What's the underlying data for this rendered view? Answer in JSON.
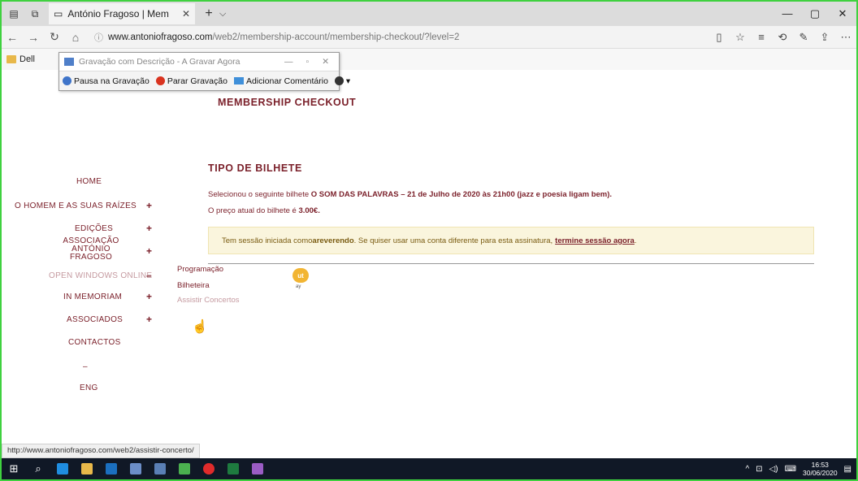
{
  "browser": {
    "tab_title": "António Fragoso | Mem",
    "url_domain": "www.antoniofragoso.com",
    "url_path": "/web2/membership-account/membership-checkout/?level=2",
    "favorites": [
      "Dell"
    ]
  },
  "recorder": {
    "title": "Gravação com Descrição - A Gravar Agora",
    "pause_label": "Pausa na Gravação",
    "stop_label": "Parar Gravação",
    "comment_label": "Adicionar Comentário"
  },
  "page": {
    "heading_checkout": "MEMBERSHIP CHECKOUT",
    "heading_ticket": "TIPO DE BILHETE",
    "ticket_prefix": "Selecionou o seguinte bilhete ",
    "ticket_name": "O SOM DAS PALAVRAS – 21 de Julho de 2020 às 21h00 (jazz e poesia ligam bem).",
    "price_prefix": "O preço atual do bilhete é ",
    "price_value": "3.00€.",
    "notice_prefix": "Tem sessão iniciada como ",
    "notice_user": "areverendo",
    "notice_middle": ". Se quiser usar uma conta diferente para esta assinatura,",
    "notice_link": "termine sessão agora",
    "badge_text": "ut",
    "badge_sub": "ay"
  },
  "nav": {
    "home": "HOME",
    "homem": "O HOMEM E AS SUAS RAÍZES",
    "edicoes": "EDIÇÕES",
    "associacao": "ASSOCIAÇÃO ANTÓNIO FRAGOSO",
    "open_windows": "OPEN WINDOWS ONLINE",
    "in_memoriam": "IN MEMORIAM",
    "associados": "ASSOCIADOS",
    "contactos": "CONTACTOS",
    "dash": "–",
    "eng": "ENG",
    "plus": "+",
    "minus": "–",
    "submenu": [
      "Programação",
      "Bilheteira",
      "Assistir Concertos"
    ]
  },
  "status_url": "http://www.antoniofragoso.com/web2/assistir-concerto/",
  "clock": {
    "time": "16:53",
    "date": "30/06/2020"
  }
}
